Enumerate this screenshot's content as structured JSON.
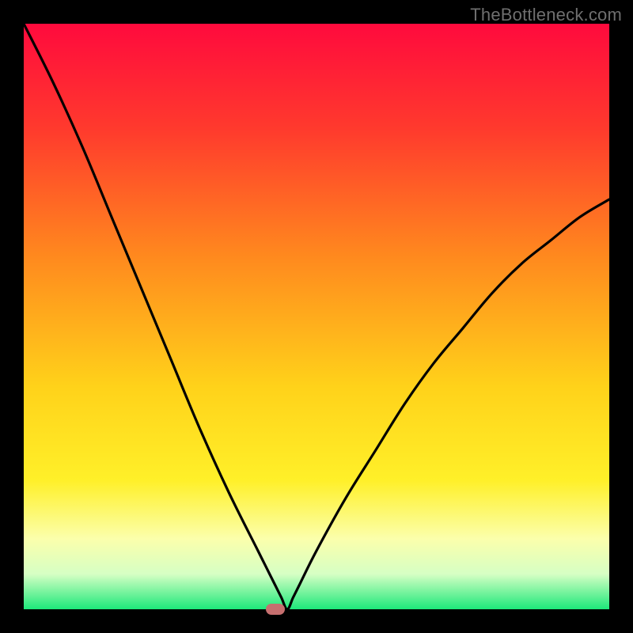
{
  "watermark": "TheBottleneck.com",
  "colors": {
    "frame_background": "#000000",
    "watermark_text": "#6f6f6f",
    "curve": "#000000",
    "marker": "#c66f6f",
    "gradient_stops": [
      {
        "offset": 0.0,
        "color": "#ff0a3d"
      },
      {
        "offset": 0.18,
        "color": "#ff3a2d"
      },
      {
        "offset": 0.4,
        "color": "#ff8a1e"
      },
      {
        "offset": 0.62,
        "color": "#ffd21a"
      },
      {
        "offset": 0.78,
        "color": "#fff029"
      },
      {
        "offset": 0.88,
        "color": "#fbffac"
      },
      {
        "offset": 0.94,
        "color": "#d6ffc4"
      },
      {
        "offset": 1.0,
        "color": "#1de87a"
      }
    ]
  },
  "chart_data": {
    "type": "line",
    "title": "",
    "xlabel": "",
    "ylabel": "",
    "xlim": [
      0,
      100
    ],
    "ylim": [
      0,
      100
    ],
    "series": [
      {
        "name": "bottleneck-curve",
        "x": [
          0,
          5,
          10,
          15,
          20,
          25,
          30,
          35,
          40,
          41,
          42,
          43,
          44,
          45,
          46,
          47,
          50,
          55,
          60,
          65,
          70,
          75,
          80,
          85,
          90,
          95,
          100
        ],
        "values": [
          100,
          90,
          79,
          67,
          55,
          43,
          31,
          20,
          10,
          8,
          6,
          4,
          2,
          0,
          2,
          4,
          10,
          19,
          27,
          35,
          42,
          48,
          54,
          59,
          63,
          67,
          70
        ]
      }
    ],
    "marker": {
      "x": 43,
      "y": 0
    }
  }
}
